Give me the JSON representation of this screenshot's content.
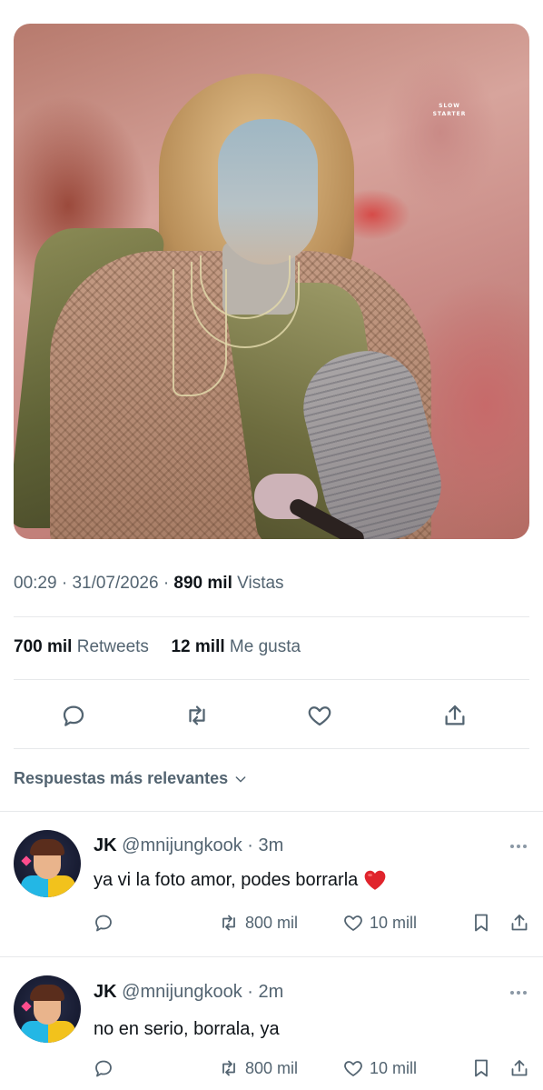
{
  "tweet": {
    "media": {
      "alt_icon": "photo-performer",
      "watermark_line1": "SLOW",
      "watermark_line2": "STARTER"
    },
    "time": "00:29",
    "date": "31/07/2026",
    "views_count": "890 mil",
    "views_label": "Vistas",
    "retweets_count": "700 mil",
    "retweets_label": "Retweets",
    "likes_count": "12 mill",
    "likes_label": "Me gusta",
    "actions": {
      "reply_icon": "reply-icon",
      "retweet_icon": "retweet-icon",
      "like_icon": "heart-icon",
      "share_icon": "share-icon"
    }
  },
  "replies_sort_label": "Respuestas más relevantes",
  "replies": [
    {
      "name": "JK",
      "handle": "@mnijungkook",
      "time": "3m",
      "text": "ya vi la foto amor, podes borrarla",
      "emoji": "red-heart-emoji",
      "retweets": "800 mil",
      "likes": "10 mill"
    },
    {
      "name": "JK",
      "handle": "@mnijungkook",
      "time": "2m",
      "text": "no en serio, borrala, ya",
      "retweets": "800 mil",
      "likes": "10 mill"
    }
  ],
  "colors": {
    "text": "#0f1419",
    "secondary": "#536471",
    "divider": "#e7e9eb",
    "heart": "#f91880"
  }
}
